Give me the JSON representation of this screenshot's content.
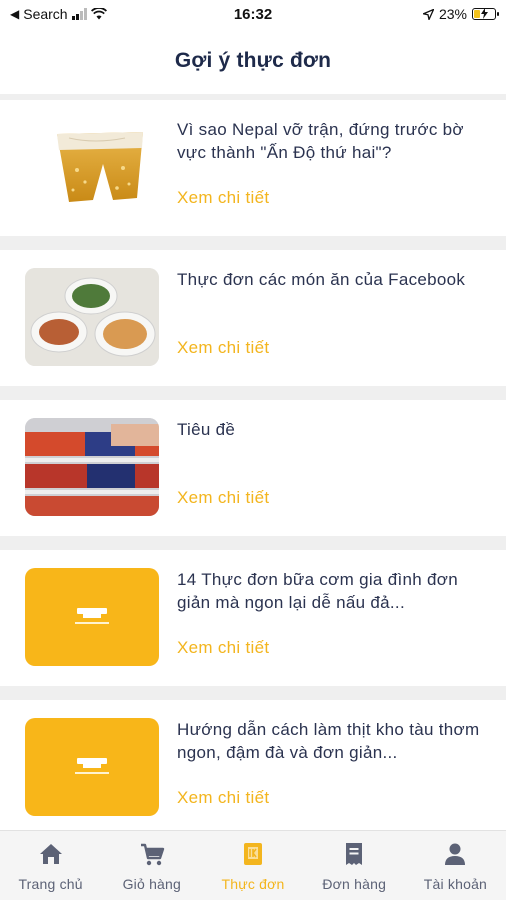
{
  "status_bar": {
    "back_label": "Search",
    "time": "16:32",
    "battery": "23%"
  },
  "header": {
    "title": "Gợi ý thực đơn"
  },
  "articles": [
    {
      "title": "Vì sao Nepal vỡ trận, đứng trước bờ vực thành \"Ấn Độ thứ hai\"?",
      "link": "Xem chi tiết",
      "thumb": "beer-shorts-image"
    },
    {
      "title": "Thực đơn các món ăn của Facebook",
      "link": "Xem chi tiết",
      "thumb": "food-dishes-image"
    },
    {
      "title": "Tiêu đề",
      "link": "Xem chi tiết",
      "thumb": "store-shelf-image"
    },
    {
      "title": "14 Thực đơn bữa cơm gia đình đơn giản mà ngon lại dễ nấu đả...",
      "link": "Xem chi tiết",
      "thumb": "placeholder-logo-image"
    },
    {
      "title": "Hướng dẫn cách làm thịt kho tàu thơm ngon, đậm đà và đơn giản...",
      "link": "Xem chi tiết",
      "thumb": "placeholder-logo-image"
    }
  ],
  "bottom_nav": [
    {
      "label": "Trang chủ",
      "icon": "home-icon"
    },
    {
      "label": "Giỏ hàng",
      "icon": "cart-icon"
    },
    {
      "label": "Thực đơn",
      "icon": "menu-book-icon"
    },
    {
      "label": "Đơn hàng",
      "icon": "receipt-icon"
    },
    {
      "label": "Tài khoản",
      "icon": "user-icon"
    }
  ],
  "colors": {
    "accent": "#f3b51e",
    "title_text": "#1e2a4a",
    "nav_text": "#5c6276"
  }
}
